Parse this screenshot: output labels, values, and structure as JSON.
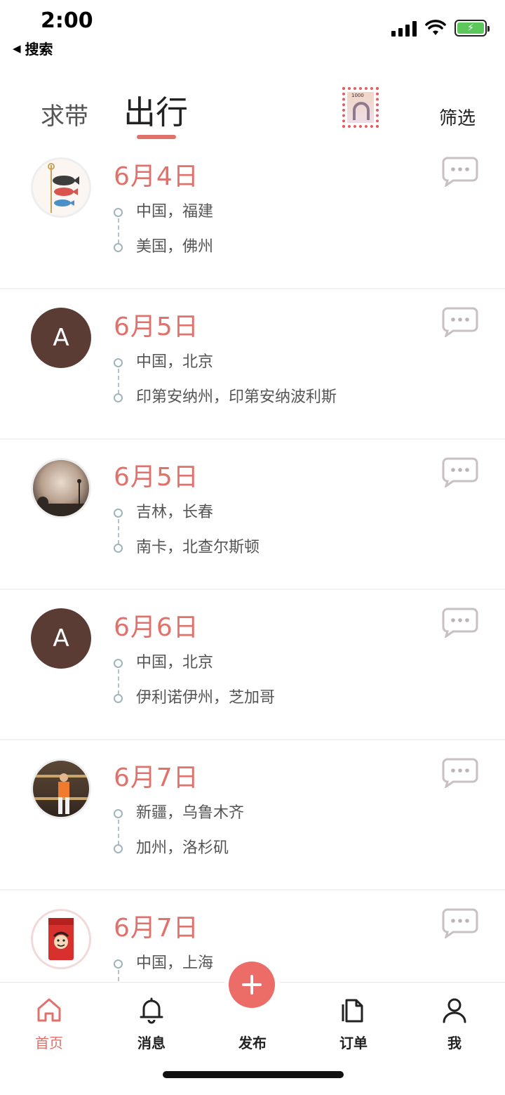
{
  "status": {
    "time": "2:00",
    "back_label": "搜索"
  },
  "nav": {
    "tab_help": "求带",
    "tab_travel": "出行",
    "filter": "筛选",
    "stamp_value": "1000"
  },
  "trips": [
    {
      "avatar": "fish-kite",
      "date": "6月4日",
      "from": "中国，福建",
      "to": "美国，佛州"
    },
    {
      "avatar": "letter",
      "letter": "A",
      "date": "6月5日",
      "from": "中国，北京",
      "to": "印第安纳州，印第安纳波利斯"
    },
    {
      "avatar": "sky-photo",
      "date": "6月5日",
      "from": "吉林，长春",
      "to": "南卡，北查尔斯顿"
    },
    {
      "avatar": "letter",
      "letter": "A",
      "date": "6月6日",
      "from": "中国，北京",
      "to": "伊利诺伊州，芝加哥"
    },
    {
      "avatar": "person-photo",
      "date": "6月7日",
      "from": "新疆，乌鲁木齐",
      "to": "加州，洛杉矶"
    },
    {
      "avatar": "milk-carton",
      "date": "6月7日",
      "from": "中国，上海",
      "to": ""
    }
  ],
  "tabbar": {
    "home": "首页",
    "messages": "消息",
    "post": "发布",
    "orders": "订单",
    "me": "我"
  },
  "colors": {
    "accent": "#e0716b",
    "post_button": "#ec6c67",
    "avatar_letter_bg": "#5a3c35"
  }
}
